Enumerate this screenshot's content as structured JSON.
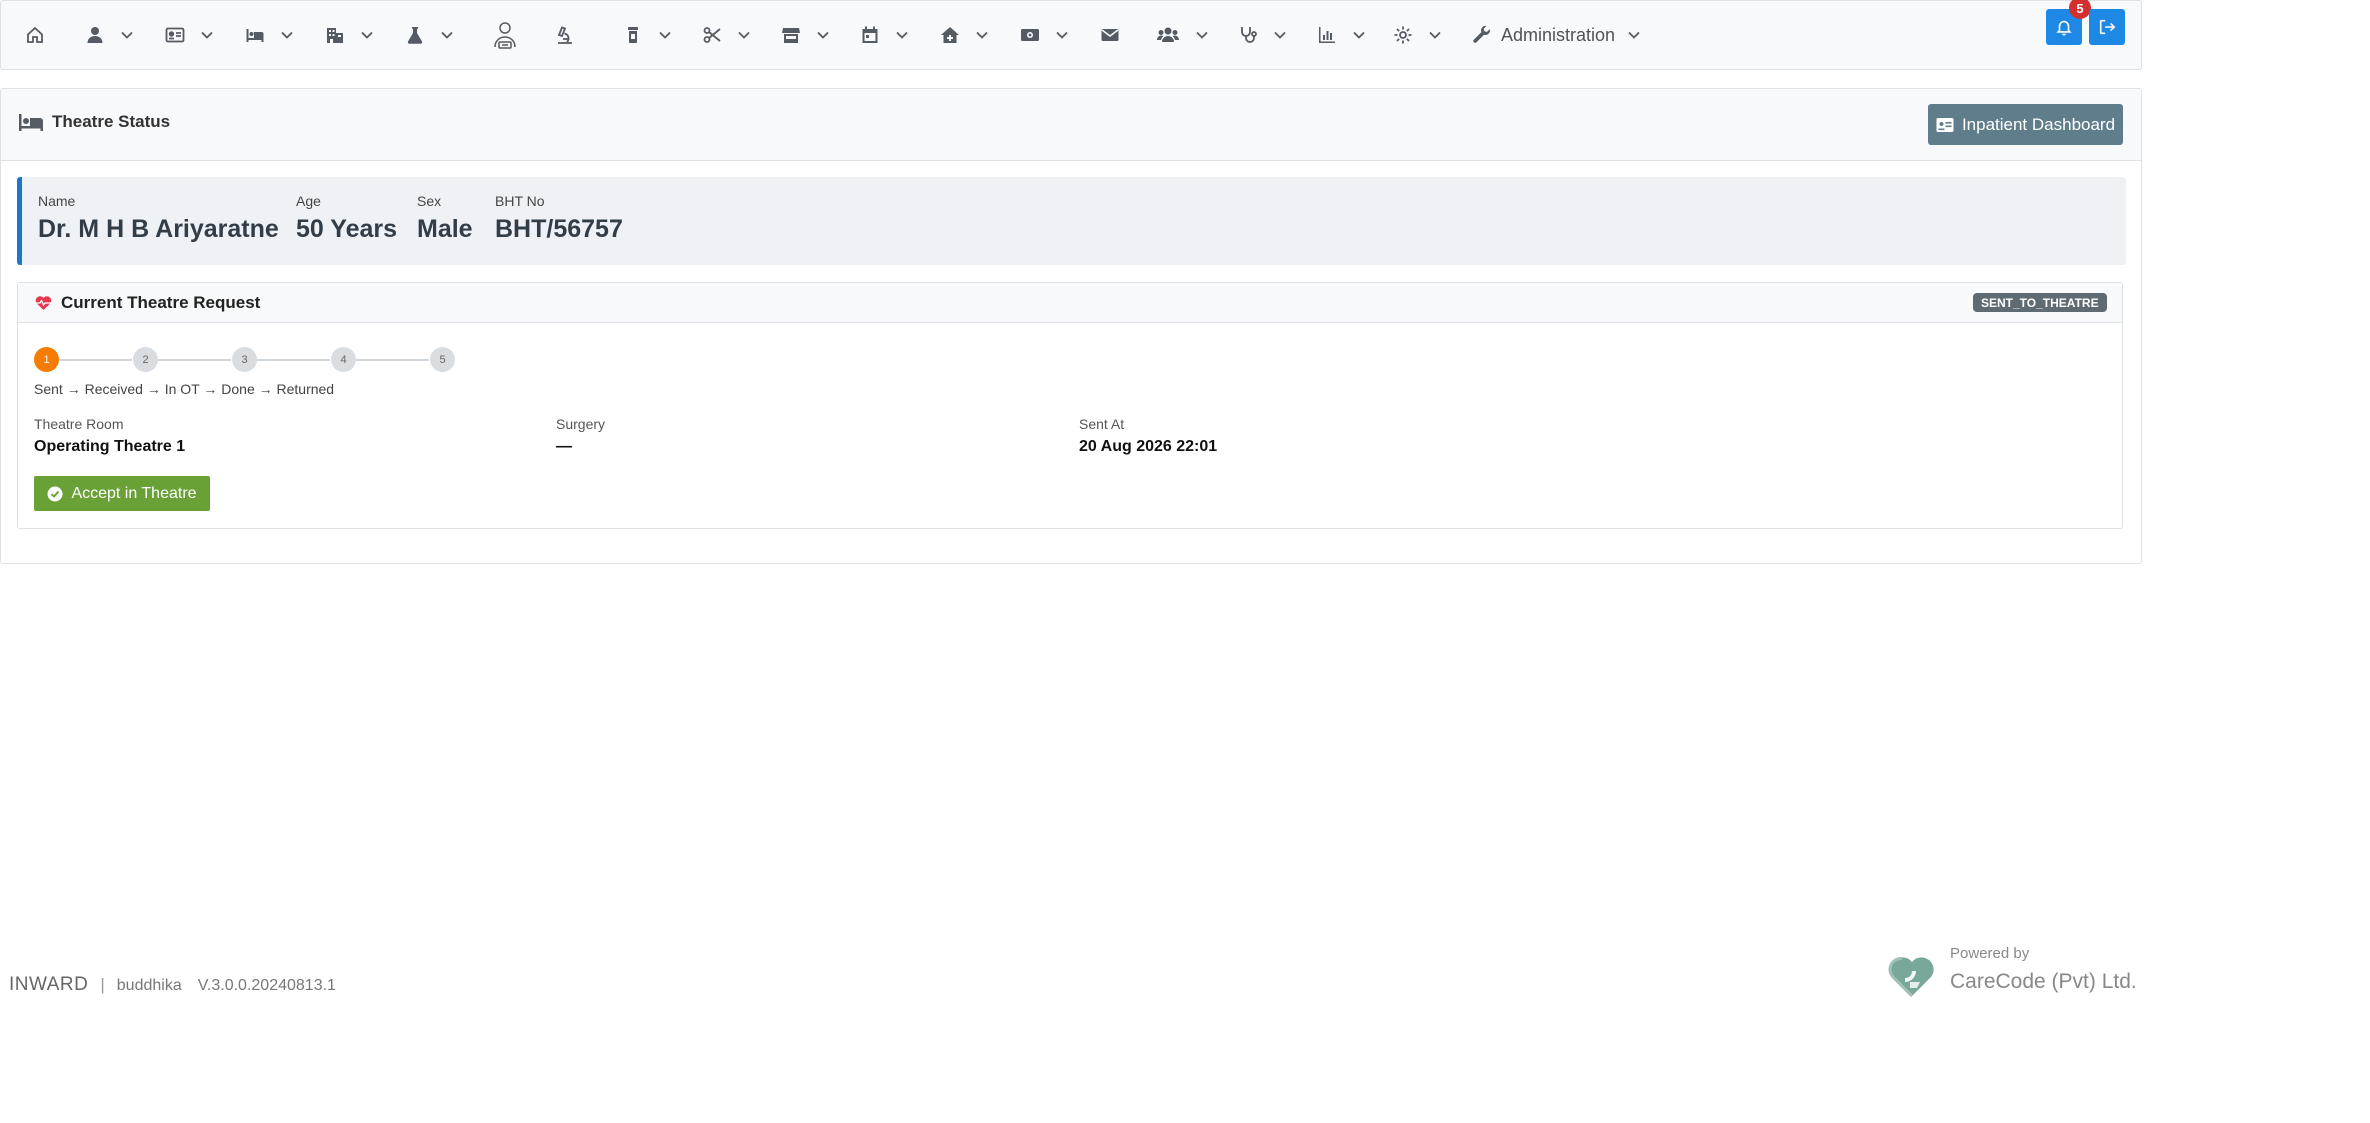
{
  "navbar": {
    "items": [
      {
        "icon": "home-icon",
        "dropdown": false
      },
      {
        "icon": "user-icon",
        "dropdown": true
      },
      {
        "icon": "id-card-icon",
        "dropdown": true
      },
      {
        "icon": "bed-icon",
        "dropdown": true
      },
      {
        "icon": "building-icon",
        "dropdown": true
      },
      {
        "icon": "flask-icon",
        "dropdown": true
      },
      {
        "icon": "doctor-icon",
        "dropdown": false
      },
      {
        "icon": "microscope-icon",
        "dropdown": false
      },
      {
        "icon": "pill-bottle-icon",
        "dropdown": true
      },
      {
        "icon": "scissors-icon",
        "dropdown": true
      },
      {
        "icon": "store-icon",
        "dropdown": true
      },
      {
        "icon": "calendar-icon",
        "dropdown": true
      },
      {
        "icon": "house-medical-icon",
        "dropdown": true
      },
      {
        "icon": "money-icon",
        "dropdown": true
      },
      {
        "icon": "envelope-icon",
        "dropdown": false
      },
      {
        "icon": "users-icon",
        "dropdown": true
      },
      {
        "icon": "stethoscope-icon",
        "dropdown": true
      },
      {
        "icon": "chart-icon",
        "dropdown": true
      },
      {
        "icon": "gear-icon",
        "dropdown": true
      }
    ],
    "administration_label": "Administration",
    "notification_count": "5",
    "accent_color": "#1e88e5",
    "badge_color": "#d32f2f"
  },
  "panel": {
    "title": "Theatre Status",
    "dashboard_button": "Inpatient Dashboard"
  },
  "patient": {
    "name_label": "Name",
    "name": "Dr. M H B Ariyaratne",
    "age_label": "Age",
    "age": "50 Years",
    "sex_label": "Sex",
    "sex": "Male",
    "bht_label": "BHT No",
    "bht": "BHT/56757"
  },
  "request": {
    "title": "Current Theatre Request",
    "status": "SENT_TO_THEATRE",
    "steps": [
      "1",
      "2",
      "3",
      "4",
      "5"
    ],
    "current_step": 1,
    "steps_caption": "Sent → Received → In OT → Done → Returned",
    "theatre_room_label": "Theatre Room",
    "theatre_room": "Operating Theatre 1",
    "surgery_label": "Surgery",
    "surgery": "—",
    "sent_at_label": "Sent At",
    "sent_at": "20 Aug 2026 22:01",
    "accept_button": "Accept in Theatre",
    "accent_color": "#f57c00",
    "accept_color": "#6aa136"
  },
  "footer": {
    "module": "INWARD",
    "separator": "|",
    "user": "buddhika",
    "version": "V.3.0.0.20240813.1",
    "powered_by": "Powered by",
    "company": "CareCode (Pvt) Ltd."
  }
}
